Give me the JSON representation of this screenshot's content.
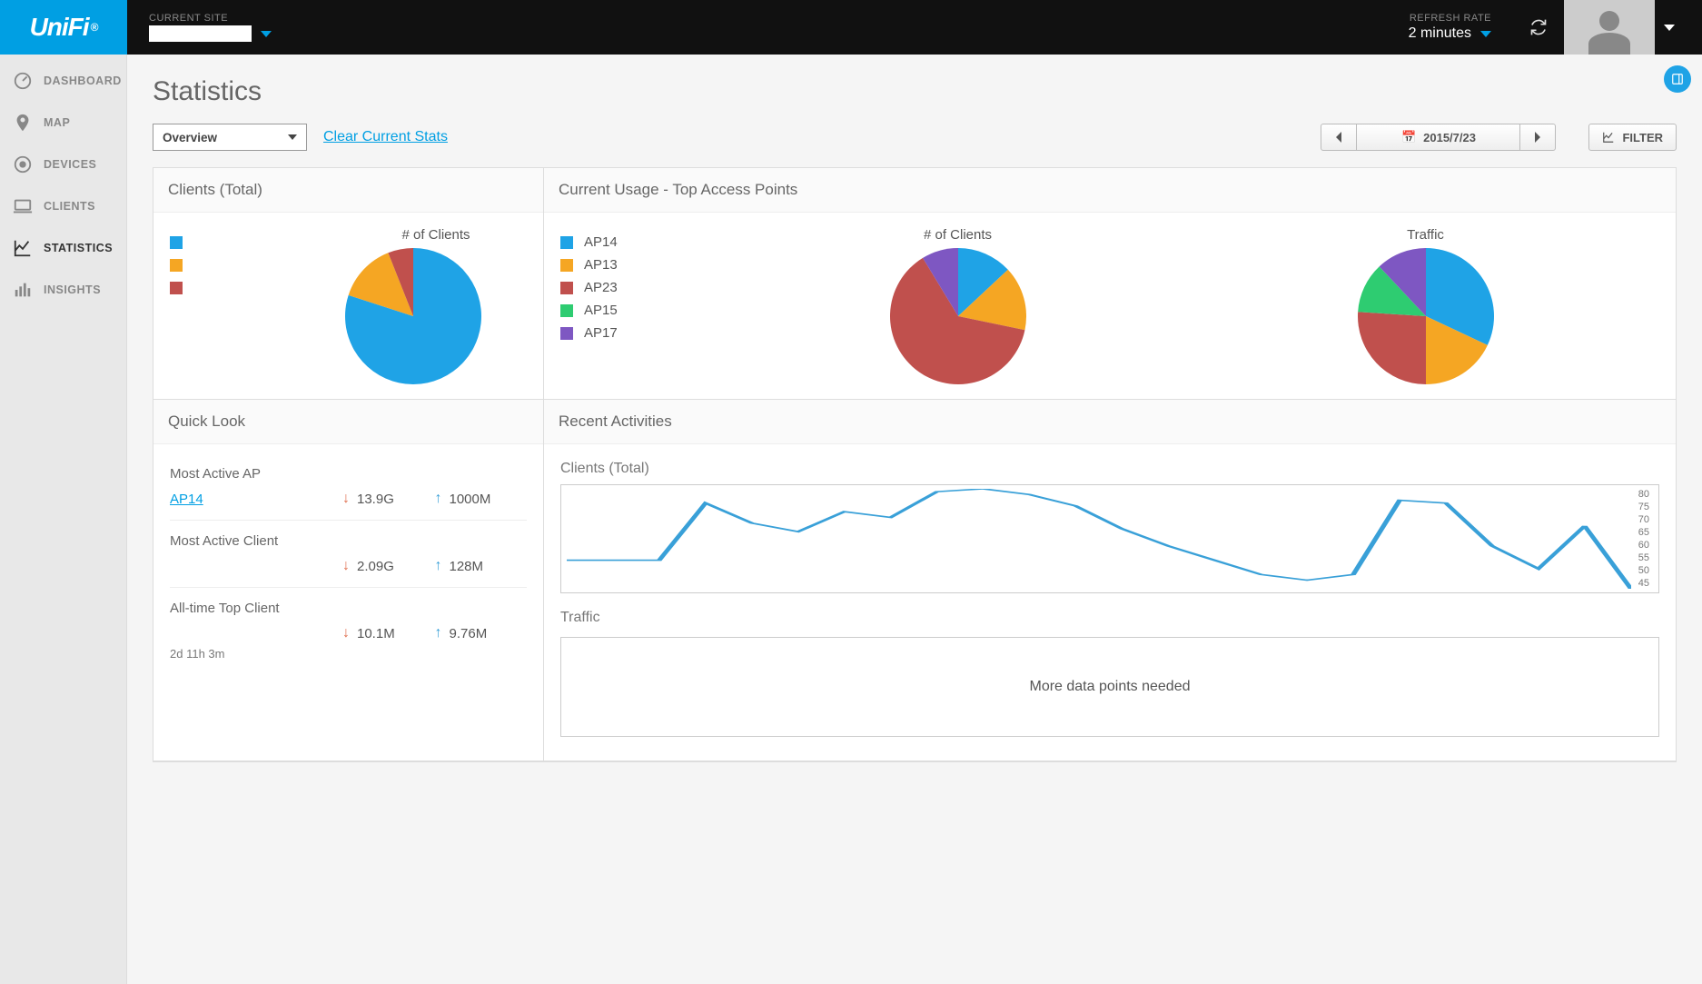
{
  "brand": "UniFi",
  "header": {
    "current_site_label": "CURRENT SITE",
    "current_site_value": "██████████",
    "refresh_label": "REFRESH RATE",
    "refresh_value": "2 minutes"
  },
  "sidebar": {
    "items": [
      {
        "id": "dashboard",
        "label": "DASHBOARD"
      },
      {
        "id": "map",
        "label": "MAP"
      },
      {
        "id": "devices",
        "label": "DEVICES"
      },
      {
        "id": "clients",
        "label": "CLIENTS"
      },
      {
        "id": "statistics",
        "label": "STATISTICS"
      },
      {
        "id": "insights",
        "label": "INSIGHTS"
      }
    ],
    "active": "statistics"
  },
  "page": {
    "title": "Statistics",
    "overview_label": "Overview",
    "clear_label": "Clear Current Stats",
    "date": "2015/7/23",
    "filter_label": "FILTER"
  },
  "panels": {
    "clients_title": "Clients (Total)",
    "top_ap_title": "Current Usage - Top Access Points",
    "quicklook_title": "Quick Look",
    "recent_title": "Recent Activities"
  },
  "chart_data": [
    {
      "id": "clients_total_pie",
      "type": "pie",
      "title": "# of Clients",
      "series": [
        {
          "name": "████████",
          "value": 80,
          "color": "#1fa3e6"
        },
        {
          "name": "████",
          "value": 14,
          "color": "#f5a623"
        },
        {
          "name": "████████",
          "value": 6,
          "color": "#c0504d"
        }
      ]
    },
    {
      "id": "top_ap_clients_pie",
      "type": "pie",
      "title": "# of Clients",
      "series": [
        {
          "name": "AP14",
          "value": 12,
          "color": "#1fa3e6"
        },
        {
          "name": "AP13",
          "value": 14,
          "color": "#f5a623"
        },
        {
          "name": "AP23",
          "value": 58,
          "color": "#c0504d"
        },
        {
          "name": "AP15",
          "value": 0,
          "color": "#2ecc71"
        },
        {
          "name": "AP17",
          "value": 8,
          "color": "#7e57c2"
        }
      ]
    },
    {
      "id": "top_ap_traffic_pie",
      "type": "pie",
      "title": "Traffic",
      "series": [
        {
          "name": "AP14",
          "value": 32,
          "color": "#1fa3e6"
        },
        {
          "name": "AP13",
          "value": 18,
          "color": "#f5a623"
        },
        {
          "name": "AP23",
          "value": 26,
          "color": "#c0504d"
        },
        {
          "name": "AP15",
          "value": 12,
          "color": "#2ecc71"
        },
        {
          "name": "AP17",
          "value": 12,
          "color": "#7e57c2"
        }
      ]
    },
    {
      "id": "clients_timeline",
      "type": "line",
      "title": "Clients (Total)",
      "ylim": [
        45,
        80
      ],
      "yticks": [
        80,
        75,
        70,
        65,
        60,
        55,
        50,
        45
      ],
      "x": [
        0,
        1,
        2,
        3,
        4,
        5,
        6,
        7,
        8,
        9,
        10,
        11,
        12,
        13,
        14,
        15,
        16,
        17,
        18,
        19,
        20,
        21,
        22,
        23
      ],
      "values": [
        55,
        55,
        55,
        75,
        68,
        65,
        72,
        70,
        79,
        80,
        78,
        74,
        66,
        60,
        55,
        50,
        48,
        50,
        76,
        75,
        60,
        52,
        67,
        45
      ]
    }
  ],
  "quicklook": {
    "most_active_ap": {
      "label": "Most Active AP",
      "name": "AP14",
      "down": "13.9G",
      "up": "1000M"
    },
    "most_active_client": {
      "label": "Most Active Client",
      "name": "███████████",
      "down": "2.09G",
      "up": "128M"
    },
    "all_time_top": {
      "label": "All-time Top Client",
      "name": "██████████",
      "down": "10.1M",
      "up": "9.76M",
      "duration": "2d 11h 3m"
    }
  },
  "recent": {
    "clients_label": "Clients (Total)",
    "traffic_label": "Traffic",
    "traffic_placeholder": "More data points needed"
  }
}
